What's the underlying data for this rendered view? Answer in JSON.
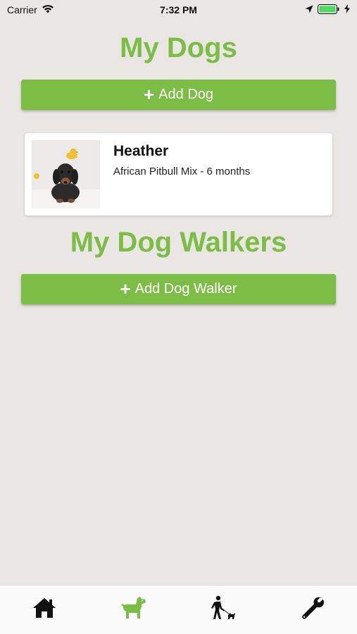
{
  "status_bar": {
    "carrier": "Carrier",
    "time": "7:32 PM"
  },
  "dogs_section": {
    "title": "My Dogs",
    "add_button_label": "Add Dog"
  },
  "dogs": [
    {
      "name": "Heather",
      "details": "African Pitbull Mix - 6 months"
    }
  ],
  "walkers_section": {
    "title": "My Dog Walkers",
    "add_button_label": "Add Dog Walker"
  },
  "tabs": [
    {
      "icon": "home-icon",
      "active": false
    },
    {
      "icon": "dog-icon",
      "active": true
    },
    {
      "icon": "dog-walker-icon",
      "active": false
    },
    {
      "icon": "wrench-icon",
      "active": false
    }
  ],
  "colors": {
    "accent": "#7cbe45",
    "background": "#e9e6e3",
    "inactive_icon": "#111111"
  }
}
